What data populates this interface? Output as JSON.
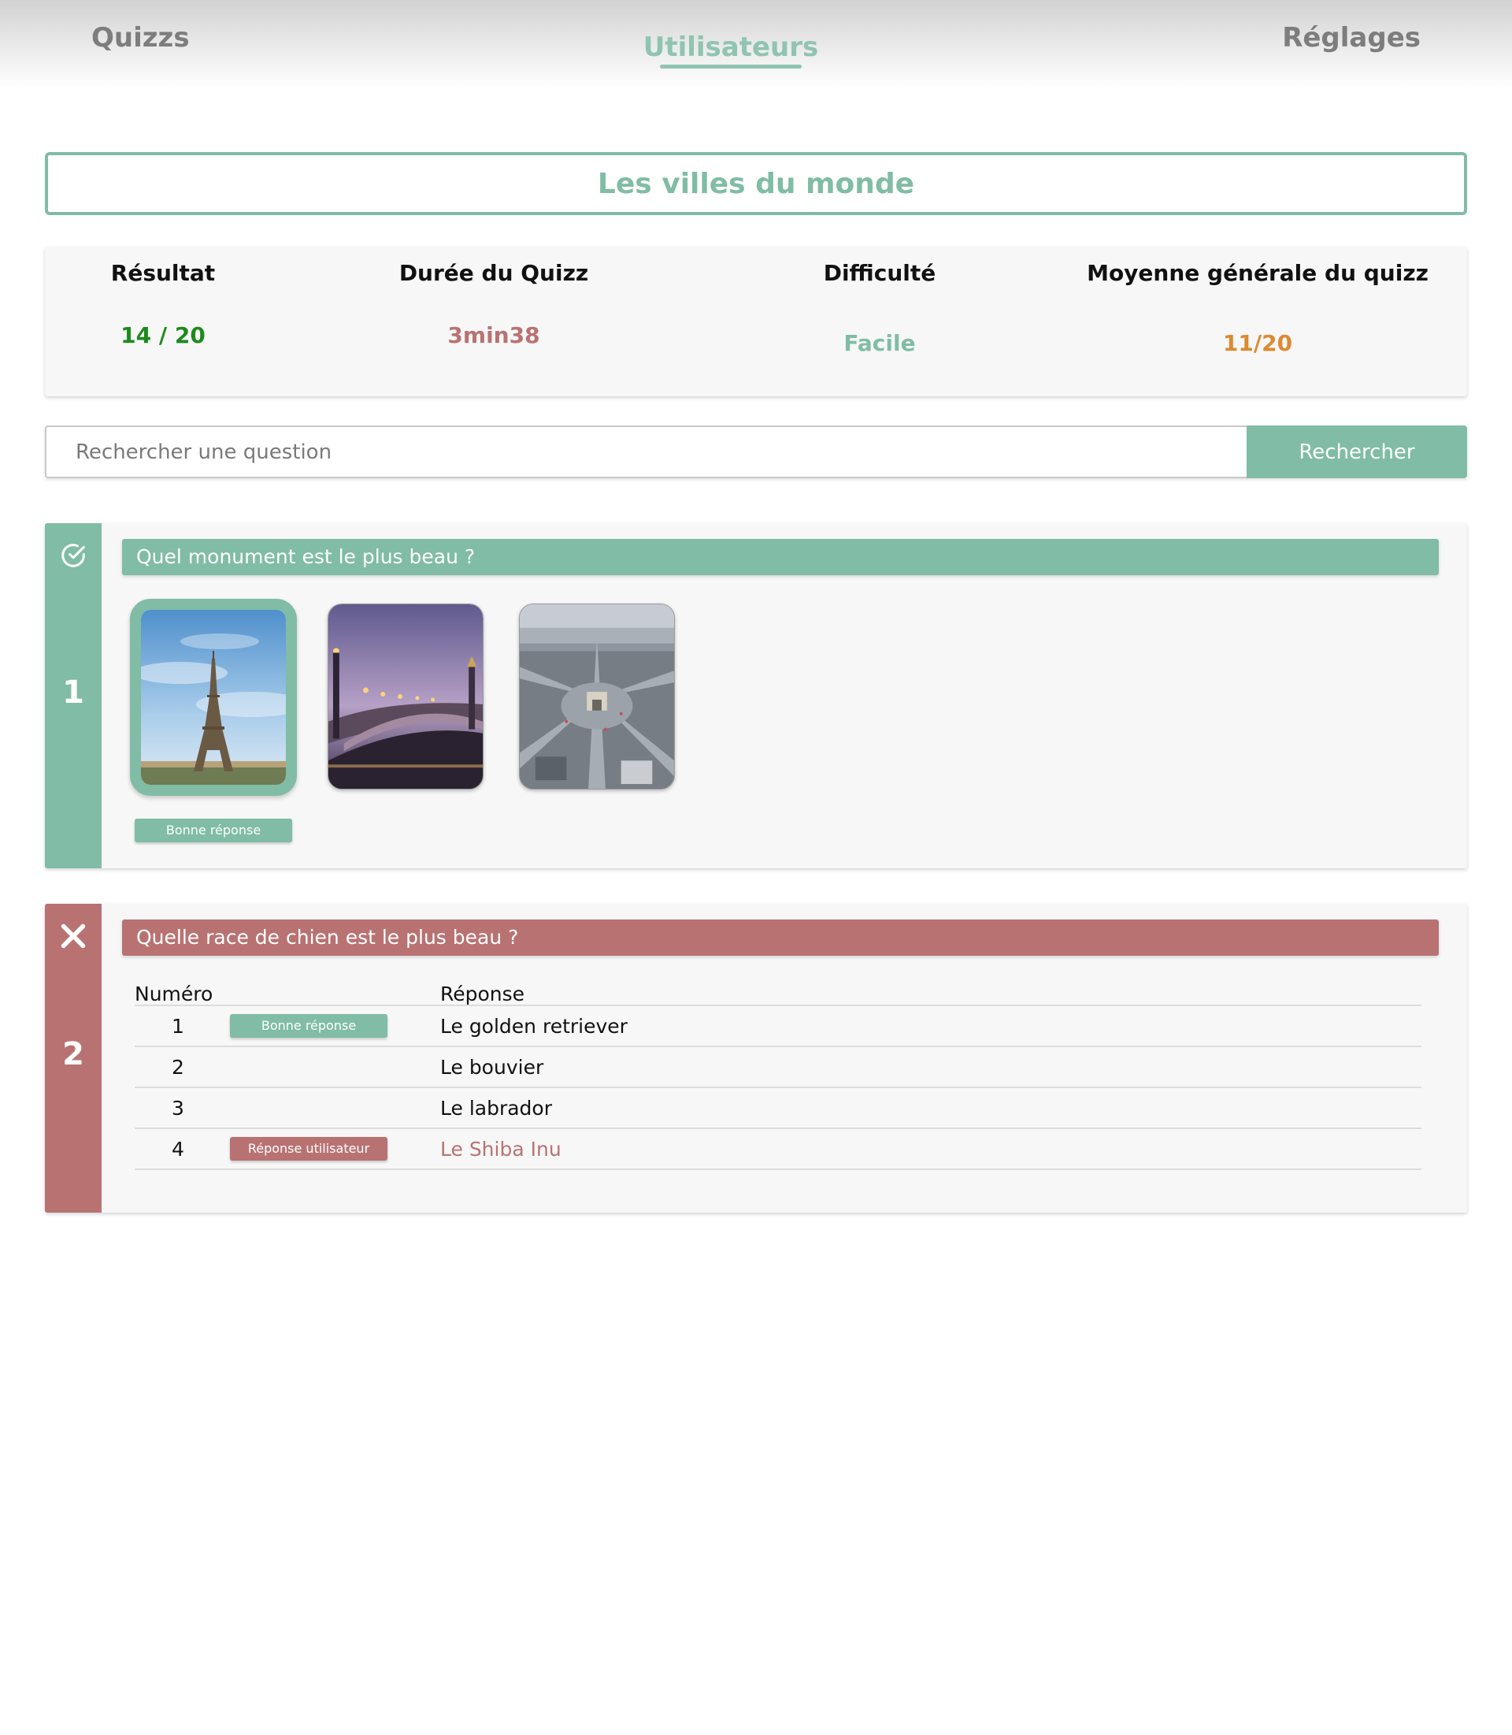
{
  "nav": {
    "quizzs": "Quizzs",
    "users": "Utilisateurs",
    "settings": "Réglages"
  },
  "quiz": {
    "title": "Les villes du monde"
  },
  "stats": {
    "result_label": "Résultat",
    "result_value": "14 / 20",
    "duration_label": "Durée du Quizz",
    "duration_value": "3min38",
    "difficulty_label": "Difficulté",
    "difficulty_value": "Facile",
    "average_label": "Moyenne générale du quizz",
    "average_value": "11/20"
  },
  "search": {
    "placeholder": "Rechercher une question",
    "button_label": "Rechercher"
  },
  "questions": [
    {
      "number": "1",
      "status": "correct",
      "status_icon": "check-circle-icon",
      "text": "Quel monument est le plus beau ?",
      "images": [
        "eiffel-tower-photo",
        "alexandre-iii-bridge-photo",
        "arc-de-triomphe-aerial-photo"
      ],
      "selected_image": 0,
      "correct_badge": "Bonne réponse"
    },
    {
      "number": "2",
      "status": "wrong",
      "status_icon": "cross-icon",
      "text": "Quelle race de chien est le plus beau ?",
      "table_headers": {
        "number": "Numéro",
        "response": "Réponse"
      },
      "answers": [
        {
          "num": "1",
          "badge": "Bonne réponse",
          "text": "Le golden retriever"
        },
        {
          "num": "2",
          "badge": "",
          "text": "Le bouvier"
        },
        {
          "num": "3",
          "badge": "",
          "text": "Le labrador"
        },
        {
          "num": "4",
          "badge": "Réponse utilisateur",
          "text": "Le Shiba Inu"
        }
      ]
    }
  ],
  "colors": {
    "accent_green": "#80bca6",
    "accent_red": "#b97272",
    "result_green": "#1e8a1e",
    "average_orange": "#dd8a32"
  }
}
